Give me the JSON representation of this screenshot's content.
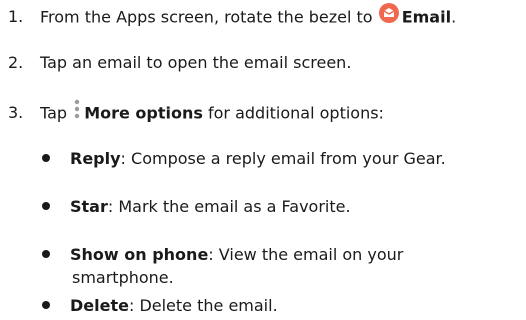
{
  "steps": [
    {
      "number": "1.",
      "text": "From the Apps screen, rotate the bezel to",
      "icon": "email-app-icon",
      "bold": "Email",
      "after": "."
    },
    {
      "number": "2.",
      "text": "Tap an email to open the email screen."
    },
    {
      "number": "3.",
      "text": "Tap",
      "icon": "more-options-icon",
      "bold": "More options",
      "after": " for additional options:"
    }
  ],
  "bullets": [
    {
      "term": "Reply",
      "desc": ": Compose a reply email from your Gear."
    },
    {
      "term": "Star",
      "desc": ": Mark the email as a Favorite."
    },
    {
      "term": "Show on phone",
      "desc": ": View the email on your",
      "desc_cont": "smartphone."
    },
    {
      "term": "Delete",
      "desc": ": Delete the email."
    }
  ],
  "colors": {
    "email_icon": "#f2684f",
    "text": "#1a1a1a"
  }
}
